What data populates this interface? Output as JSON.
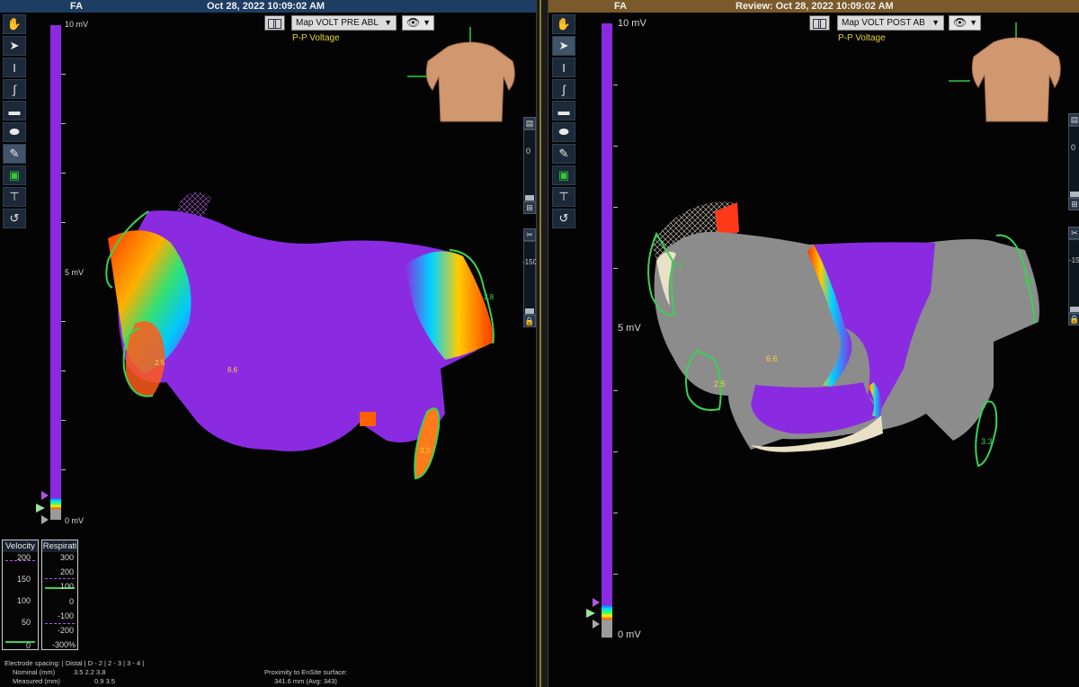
{
  "left_pane": {
    "header": {
      "left": "FA",
      "center": "Oct 28, 2022 10:09:02 AM"
    },
    "map_select": "Map VOLT PRE ABL",
    "map_subtitle": "P-P Voltage",
    "scale": {
      "top": "10 mV",
      "mid": "5 mV",
      "bottom": "0 mV"
    },
    "labels": {
      "a": "2.8",
      "b": "2.5",
      "c": "6.6",
      "d": "3.3"
    },
    "velocity": {
      "title": "Velocity",
      "values": [
        "200",
        "150",
        "100",
        "50",
        "0"
      ]
    },
    "respiration": {
      "title": "Respirati",
      "values": [
        "300",
        "200",
        "100",
        "0",
        "-100",
        "-200",
        "-300%"
      ]
    },
    "electrode": {
      "header": "Electrode spacing: | Distal | D - 2 | 2 - 3 | 3 - 4 |",
      "nominal_label": "Nominal (mm)",
      "nominal_values": "3.5     2.2     3.8",
      "measured_label": "Measured (mm)",
      "measured_values": "0.9     3.5"
    },
    "proximity": {
      "label": "Proximity to EnSite surface:",
      "value": "341.6 mm (Avg: 343)"
    }
  },
  "right_pane": {
    "header": {
      "left": "FA",
      "center": "Review: Oct 28, 2022 10:09:02 AM"
    },
    "map_select": "Map VOLT POST AB",
    "map_subtitle": "P-P Voltage",
    "scale": {
      "top": "10 mV",
      "mid": "5 mV",
      "bottom": "0 mV"
    },
    "labels": {
      "a": "2.3",
      "b": "2.8",
      "c": "6.6",
      "d": "2.5",
      "e": "3.3"
    },
    "slider_values": {
      "upper": "0",
      "lower": "-150"
    },
    "slider_values_right": {
      "upper": "0",
      "lower": "-15"
    }
  },
  "colors": {
    "scar_purple": "#8a2be2",
    "border_green": "#39d353",
    "healthy_grey": "#8c8c8c",
    "subtitle_yellow": "#e6d23c"
  },
  "icons": [
    "hand-icon",
    "pointer-icon",
    "cursor-text-icon",
    "curve-icon",
    "ruler-icon",
    "ellipse-icon",
    "brush-icon",
    "layer-icon",
    "stamp-icon",
    "catheter-icon"
  ]
}
